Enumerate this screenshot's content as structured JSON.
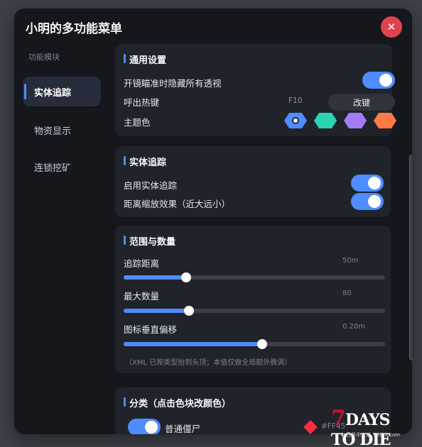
{
  "window": {
    "title": "小明的多功能菜单",
    "close_icon": "✕"
  },
  "sidebar": {
    "heading": "功能模块",
    "items": [
      {
        "label": "实体追踪",
        "active": true
      },
      {
        "label": "物资显示",
        "active": false
      },
      {
        "label": "连锁挖矿",
        "active": false
      }
    ]
  },
  "general": {
    "title": "通用设置",
    "hide_perspective_label": "开镜瞄准时隐藏所有透视",
    "hide_perspective_on": true,
    "hotkey_label": "呼出热键",
    "hotkey_value": "F10",
    "rebind_label": "改键",
    "theme_label": "主题色",
    "theme_colors": [
      "#4f8cff",
      "#2dd4b4",
      "#a37bf5",
      "#ff7a45"
    ],
    "theme_selected": 0
  },
  "entity_tracking": {
    "title": "实体追踪",
    "enable_label": "启用实体追踪",
    "enable_on": true,
    "distance_scale_label": "距离缩放效果（近大远小）",
    "distance_scale_on": true
  },
  "range": {
    "title": "范围与数量",
    "sliders": [
      {
        "label": "追踪距离",
        "value": "50m",
        "fraction": 0.24
      },
      {
        "label": "最大数量",
        "value": "80",
        "fraction": 0.25
      },
      {
        "label": "图标垂直偏移",
        "value": "0.20m",
        "fraction": 0.53
      }
    ],
    "note": "（XML 已按类型抬到头顶；本值仅做全局额外微调）"
  },
  "category": {
    "title": "分类（点击色块改颜色）",
    "items": [
      {
        "label": "普通僵尸",
        "enabled": true,
        "color_hex": "#FF45",
        "color": "#ff2d3d"
      }
    ]
  },
  "watermark": {
    "logo_text": "7DAYS TO DIE",
    "sub_text": "七日杀中文站 7risha.com"
  },
  "accent": "#4f8cff"
}
